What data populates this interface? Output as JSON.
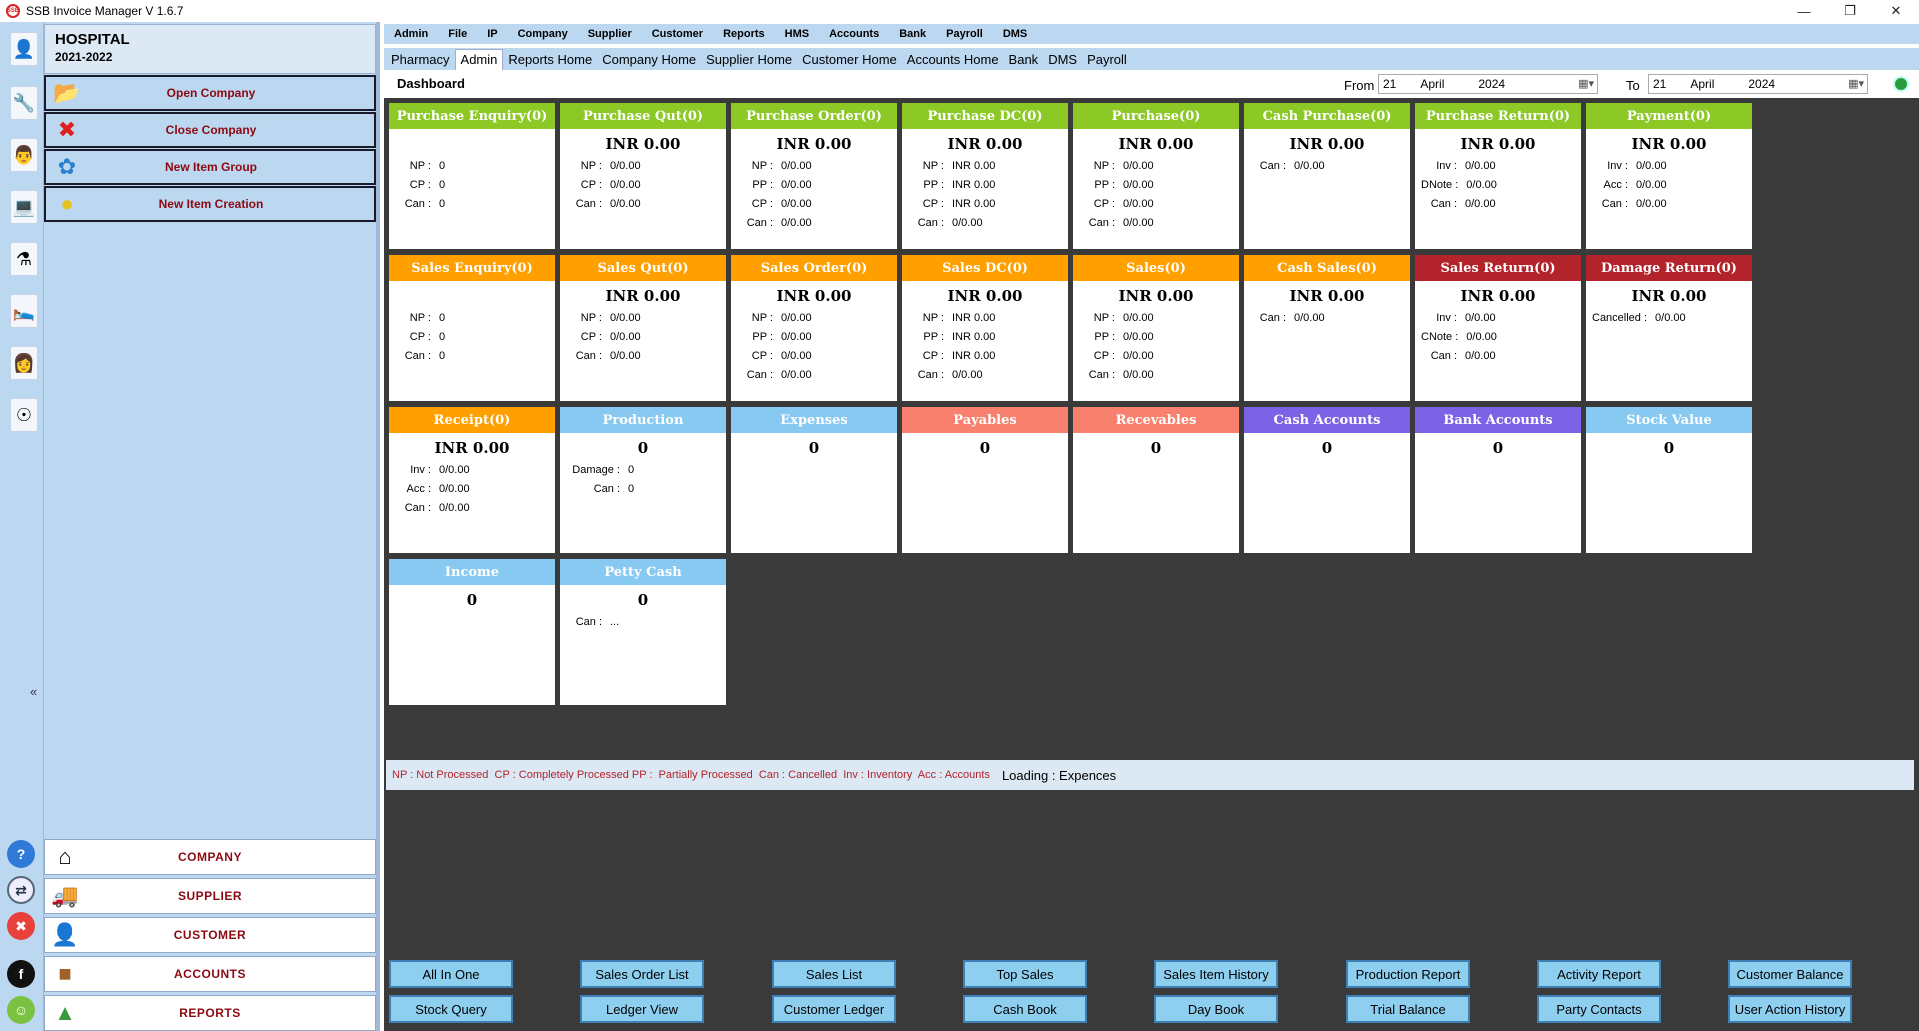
{
  "window": {
    "title": "SSB Invoice Manager V 1.6.7",
    "icon_text": "SSB"
  },
  "company": {
    "name": "HOSPITAL",
    "year": "2021-2022"
  },
  "actions": [
    {
      "label": "Open Company",
      "icon": "folder-icon"
    },
    {
      "label": "Close Company",
      "icon": "close-x-icon"
    },
    {
      "label": "New Item Group",
      "icon": "group-icon"
    },
    {
      "label": "New Item Creation",
      "icon": "coins-icon"
    }
  ],
  "nav": [
    {
      "label": "COMPANY",
      "icon": "home-icon"
    },
    {
      "label": "SUPPLIER",
      "icon": "supplier-icon"
    },
    {
      "label": "CUSTOMER",
      "icon": "customer-icon"
    },
    {
      "label": "ACCOUNTS",
      "icon": "box-icon"
    },
    {
      "label": "REPORTS",
      "icon": "reports-icon"
    }
  ],
  "menu": [
    "Admin",
    "File",
    "IP",
    "Company",
    "Supplier",
    "Customer",
    "Reports",
    "HMS",
    "Accounts",
    "Bank",
    "Payroll",
    "DMS"
  ],
  "tabs": [
    "Pharmacy",
    "Admin",
    "Reports Home",
    "Company Home",
    "Supplier Home",
    "Customer Home",
    "Accounts Home",
    "Bank",
    "DMS",
    "Payroll"
  ],
  "active_tab": "Admin",
  "dashboard": {
    "title": "Dashboard",
    "from_label": "From",
    "to_label": "To",
    "from": {
      "day": "21",
      "month": "April",
      "year": "2024"
    },
    "to": {
      "day": "21",
      "month": "April",
      "year": "2024"
    }
  },
  "colors": {
    "green": "#8cc926",
    "orange": "#ffa000",
    "red": "#b2232b",
    "blue": "#87c9f0",
    "salmon": "#f7806e",
    "purple": "#7c63e6"
  },
  "cards": [
    {
      "title": "Purchase Enquiry(0)",
      "color": "green",
      "amount": "",
      "rows": [
        [
          "NP :",
          "0"
        ],
        [
          "CP :",
          "0"
        ],
        [
          "Can :",
          "0"
        ]
      ]
    },
    {
      "title": "Purchase Qut(0)",
      "color": "green",
      "amount": "INR 0.00",
      "rows": [
        [
          "NP :",
          "0/0.00"
        ],
        [
          "CP :",
          "0/0.00"
        ],
        [
          "Can :",
          "0/0.00"
        ]
      ]
    },
    {
      "title": "Purchase Order(0)",
      "color": "green",
      "amount": "INR 0.00",
      "rows": [
        [
          "NP :",
          "0/0.00"
        ],
        [
          "PP :",
          "0/0.00"
        ],
        [
          "CP :",
          "0/0.00"
        ],
        [
          "Can :",
          "0/0.00"
        ]
      ]
    },
    {
      "title": "Purchase DC(0)",
      "color": "green",
      "amount": "INR 0.00",
      "rows": [
        [
          "NP :",
          "INR 0.00"
        ],
        [
          "PP :",
          "INR 0.00"
        ],
        [
          "CP :",
          "INR 0.00"
        ],
        [
          "Can :",
          "0/0.00"
        ]
      ]
    },
    {
      "title": "Purchase(0)",
      "color": "green",
      "amount": "INR 0.00",
      "rows": [
        [
          "NP :",
          "0/0.00"
        ],
        [
          "PP :",
          "0/0.00"
        ],
        [
          "CP :",
          "0/0.00"
        ],
        [
          "Can :",
          "0/0.00"
        ]
      ]
    },
    {
      "title": "Cash Purchase(0)",
      "color": "green",
      "amount": "INR 0.00",
      "rows": [
        [
          "Can :",
          "0/0.00"
        ]
      ]
    },
    {
      "title": "Purchase Return(0)",
      "color": "green",
      "amount": "INR 0.00",
      "rows": [
        [
          "Inv :",
          "0/0.00"
        ],
        [
          "DNote :",
          "0/0.00"
        ],
        [
          "Can :",
          "0/0.00"
        ]
      ]
    },
    {
      "title": "Payment(0)",
      "color": "green",
      "amount": "INR 0.00",
      "rows": [
        [
          "Inv :",
          "0/0.00"
        ],
        [
          "Acc :",
          "0/0.00"
        ],
        [
          "Can :",
          "0/0.00"
        ]
      ]
    },
    {
      "title": "Sales Enquiry(0)",
      "color": "orange",
      "amount": "",
      "rows": [
        [
          "NP :",
          "0"
        ],
        [
          "CP :",
          "0"
        ],
        [
          "Can :",
          "0"
        ]
      ]
    },
    {
      "title": "Sales Qut(0)",
      "color": "orange",
      "amount": "INR 0.00",
      "rows": [
        [
          "NP :",
          "0/0.00"
        ],
        [
          "CP :",
          "0/0.00"
        ],
        [
          "Can :",
          "0/0.00"
        ]
      ]
    },
    {
      "title": "Sales Order(0)",
      "color": "orange",
      "amount": "INR 0.00",
      "rows": [
        [
          "NP :",
          "0/0.00"
        ],
        [
          "PP :",
          "0/0.00"
        ],
        [
          "CP :",
          "0/0.00"
        ],
        [
          "Can :",
          "0/0.00"
        ]
      ]
    },
    {
      "title": "Sales DC(0)",
      "color": "orange",
      "amount": "INR 0.00",
      "rows": [
        [
          "NP :",
          "INR 0.00"
        ],
        [
          "PP :",
          "INR 0.00"
        ],
        [
          "CP :",
          "INR 0.00"
        ],
        [
          "Can :",
          "0/0.00"
        ]
      ]
    },
    {
      "title": "Sales(0)",
      "color": "orange",
      "amount": "INR 0.00",
      "rows": [
        [
          "NP :",
          "0/0.00"
        ],
        [
          "PP :",
          "0/0.00"
        ],
        [
          "CP :",
          "0/0.00"
        ],
        [
          "Can :",
          "0/0.00"
        ]
      ]
    },
    {
      "title": "Cash Sales(0)",
      "color": "orange",
      "amount": "INR 0.00",
      "rows": [
        [
          "Can :",
          "0/0.00"
        ]
      ]
    },
    {
      "title": "Sales Return(0)",
      "color": "red",
      "amount": "INR 0.00",
      "rows": [
        [
          "Inv :",
          "0/0.00"
        ],
        [
          "CNote :",
          "0/0.00"
        ],
        [
          "Can :",
          "0/0.00"
        ]
      ]
    },
    {
      "title": "Damage Return(0)",
      "color": "red",
      "amount": "INR 0.00",
      "rows": [
        [
          "Cancelled :",
          "0/0.00"
        ]
      ]
    },
    {
      "title": "Receipt(0)",
      "color": "orange",
      "amount": "INR 0.00",
      "rows": [
        [
          "Inv :",
          "0/0.00"
        ],
        [
          "Acc :",
          "0/0.00"
        ],
        [
          "Can :",
          "0/0.00"
        ]
      ]
    },
    {
      "title": "Production",
      "color": "blue",
      "amount": "0",
      "rows": [
        [
          "Damage :",
          "0"
        ],
        [
          "Can :",
          "0"
        ]
      ]
    },
    {
      "title": "Expenses",
      "color": "blue",
      "amount": "0",
      "rows": []
    },
    {
      "title": "Payables",
      "color": "salmon",
      "amount": "0",
      "rows": []
    },
    {
      "title": "Recevables",
      "color": "salmon",
      "amount": "0",
      "rows": []
    },
    {
      "title": "Cash Accounts",
      "color": "purple",
      "amount": "0",
      "rows": []
    },
    {
      "title": "Bank Accounts",
      "color": "purple",
      "amount": "0",
      "rows": []
    },
    {
      "title": "Stock Value",
      "color": "blue",
      "amount": "0",
      "rows": []
    },
    {
      "title": "Income",
      "color": "blue",
      "amount": "0",
      "rows": []
    },
    {
      "title": "Petty Cash",
      "color": "blue",
      "amount": "0",
      "rows": [
        [
          "Can :",
          "..."
        ]
      ]
    }
  ],
  "legend": "NP : Not Processed  CP : Completely Processed PP :  Partially Processed  Can : Cancelled  Inv : Inventory  Acc : Accounts",
  "loading": "Loading : Expences",
  "report_buttons": [
    [
      "All In One",
      "Stock Query"
    ],
    [
      "Sales Order List",
      "Ledger View"
    ],
    [
      "Sales List",
      "Customer Ledger"
    ],
    [
      "Top Sales",
      "Cash Book"
    ],
    [
      "Sales Item History",
      "Day Book"
    ],
    [
      "Production Report",
      "Trial Balance"
    ],
    [
      "Activity Report",
      "Party Contacts"
    ],
    [
      "Customer Balance",
      "User Action History"
    ]
  ]
}
